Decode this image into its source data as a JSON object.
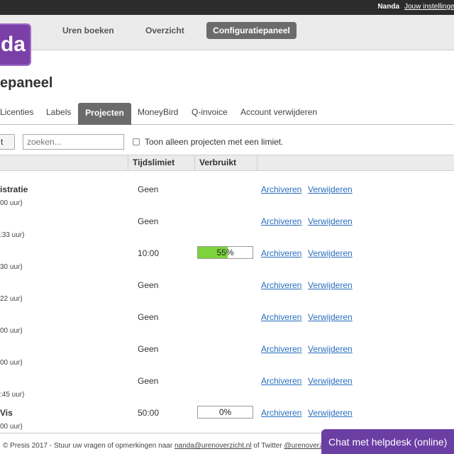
{
  "topbar": {
    "user": "Nanda",
    "settings_link": "Jouw instellingen"
  },
  "logo": {
    "text": "da"
  },
  "nav": {
    "items": [
      "Uren boeken",
      "Overzicht",
      "Configuratiepaneel"
    ],
    "active_index": 2
  },
  "page_title": "epaneel",
  "tabs": {
    "items": [
      "Licenties",
      "Labels",
      "Projecten",
      "MoneyBird",
      "Q-invoice",
      "Account verwijderen"
    ],
    "active_index": 2
  },
  "toolbar": {
    "button_label": "t",
    "search_placeholder": "zoeken...",
    "checkbox_label": "Toon alleen projecten met een limiet."
  },
  "table": {
    "headers": [
      "Tijdslimiet",
      "Verbruikt"
    ],
    "rows": [
      {
        "name": "istratie",
        "hours": "00 uur)",
        "limit": "Geen",
        "progress": null
      },
      {
        "name": "",
        "hours": ":33 uur)",
        "limit": "Geen",
        "progress": null
      },
      {
        "name": "",
        "hours": "30 uur)",
        "limit": "10:00",
        "progress": 55,
        "progress_label": "55%"
      },
      {
        "name": "",
        "hours": "22 uur)",
        "limit": "Geen",
        "progress": null
      },
      {
        "name": "",
        "hours": "00 uur)",
        "limit": "Geen",
        "progress": null
      },
      {
        "name": "",
        "hours": "00 uur)",
        "limit": "Geen",
        "progress": null
      },
      {
        "name": "",
        "hours": ":45 uur)",
        "limit": "Geen",
        "progress": null
      },
      {
        "name": "Vis",
        "hours": "00 uur)",
        "limit": "50:00",
        "progress": 0,
        "progress_label": "0%"
      }
    ],
    "archive_label": "Archiveren",
    "delete_label": "Verwijderen"
  },
  "footer": {
    "prefix": "© Presis 2017 - Stuur uw vragen of opmerkingen naar ",
    "email": "nanda@urenoverzicht.nl",
    "middle": " of Twitter ",
    "twitter": "@urenoverzicht"
  },
  "chat_label": "Chat met helpdesk (online)",
  "colors": {
    "brand": "#7b3fa8",
    "progress_fill": "#7cd33c",
    "link": "#2a6fbe",
    "chat": "#6b3ea4"
  }
}
